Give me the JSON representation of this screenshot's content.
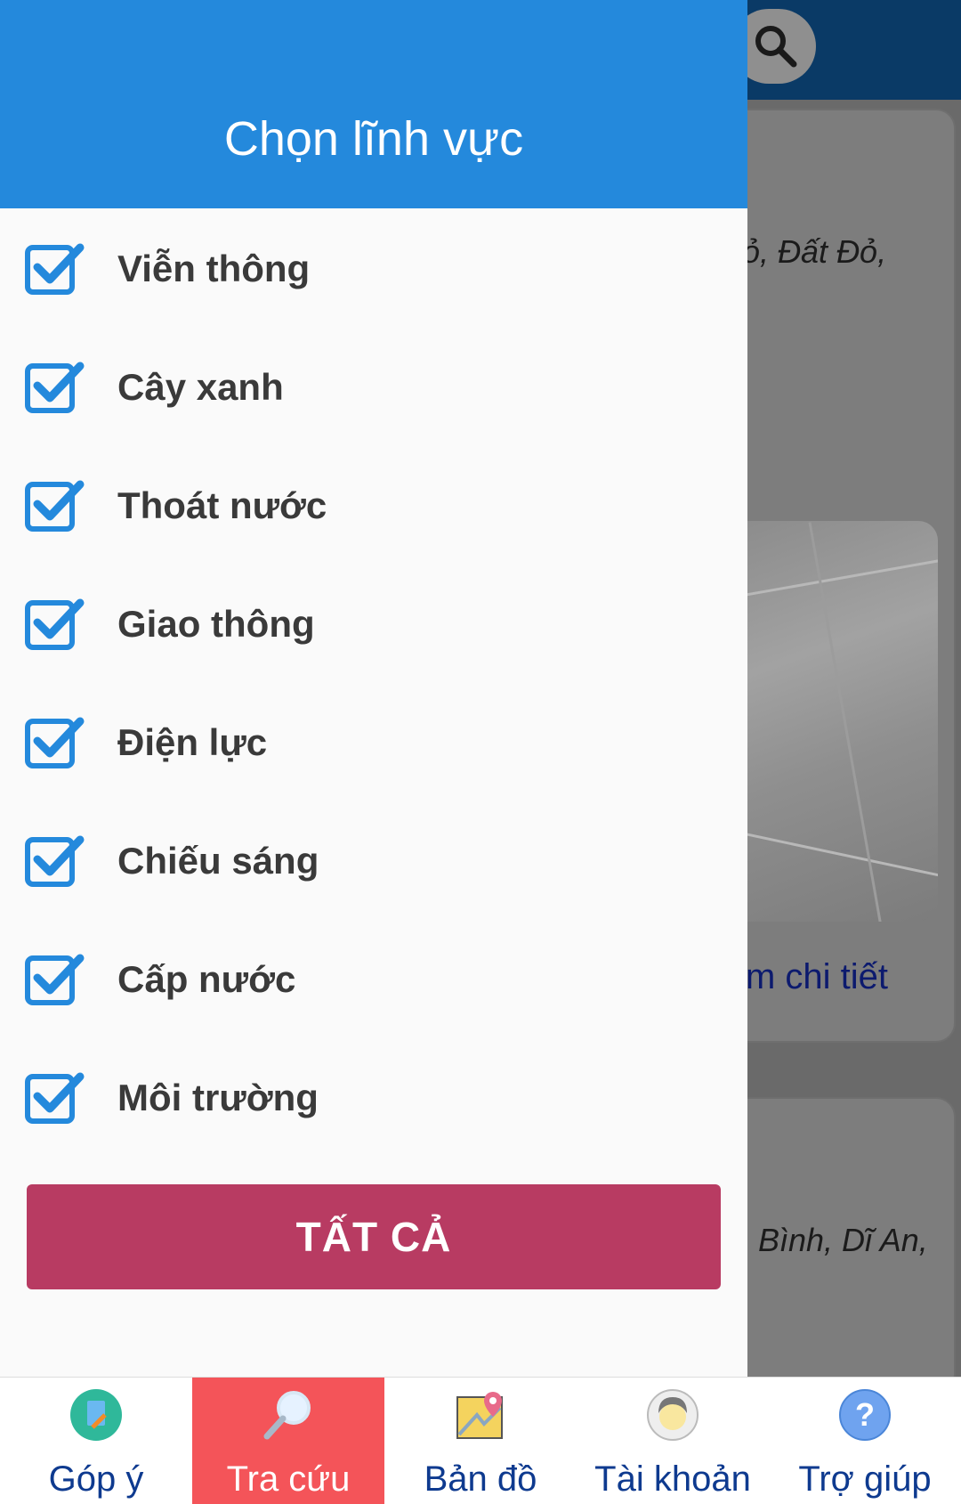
{
  "background": {
    "card1_address": "ỏ, Đất Đỏ,",
    "card1_link": "m chi tiết",
    "card2_address": "Bình, Dĩ An,"
  },
  "drawer": {
    "title": "Chọn lĩnh vực",
    "items": [
      {
        "label": "Viễn thông",
        "checked": true
      },
      {
        "label": "Cây xanh",
        "checked": true
      },
      {
        "label": "Thoát nước",
        "checked": true
      },
      {
        "label": "Giao thông",
        "checked": true
      },
      {
        "label": "Điện lực",
        "checked": true
      },
      {
        "label": "Chiếu sáng",
        "checked": true
      },
      {
        "label": "Cấp nước",
        "checked": true
      },
      {
        "label": "Môi trường",
        "checked": true
      }
    ],
    "all_button": "TẤT CẢ"
  },
  "bottom_nav": {
    "items": [
      {
        "label": "Góp ý",
        "icon": "feedback-icon"
      },
      {
        "label": "Tra cứu",
        "icon": "magnifier-icon",
        "active": true
      },
      {
        "label": "Bản đồ",
        "icon": "map-icon"
      },
      {
        "label": "Tài khoản",
        "icon": "account-icon"
      },
      {
        "label": "Trợ giúp",
        "icon": "help-icon"
      }
    ]
  },
  "colors": {
    "header": "#2489dc",
    "checkbox": "#2489dc",
    "all_button": "#b83b62",
    "nav_active": "#f45459",
    "nav_text": "#0e3a8f"
  }
}
